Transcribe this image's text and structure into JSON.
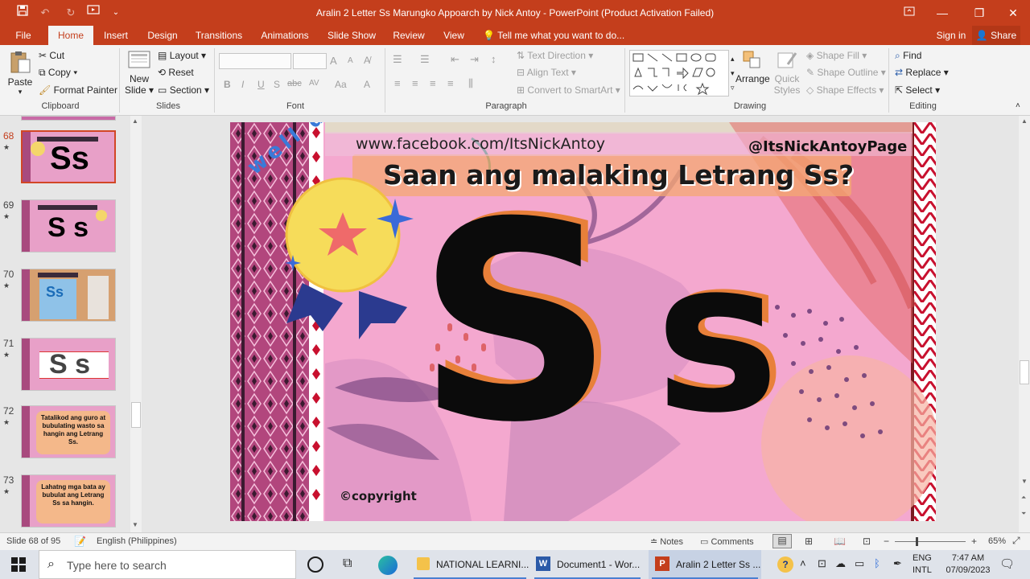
{
  "window": {
    "title": "Aralin 2 Letter Ss Marungko Appoarch by Nick Antoy - PowerPoint (Product Activation Failed)"
  },
  "tabs": [
    "File",
    "Home",
    "Insert",
    "Design",
    "Transitions",
    "Animations",
    "Slide Show",
    "Review",
    "View"
  ],
  "tell_me": "Tell me what you want to do...",
  "account": {
    "sign_in": "Sign in",
    "share": "Share"
  },
  "ribbon": {
    "clipboard": {
      "paste": "Paste",
      "cut": "Cut",
      "copy": "Copy",
      "format_painter": "Format Painter",
      "label": "Clipboard"
    },
    "slides": {
      "new_slide_line1": "New",
      "new_slide_line2": "Slide",
      "layout": "Layout",
      "reset": "Reset",
      "section": "Section",
      "label": "Slides"
    },
    "font": {
      "label": "Font",
      "bold": "B",
      "italic": "I",
      "underline": "U",
      "shadow": "S",
      "strike": "abc",
      "spacing": "AV",
      "case": "Aa",
      "color": "A",
      "grow": "A",
      "shrink": "A"
    },
    "paragraph": {
      "text_direction": "Text Direction",
      "align_text": "Align Text",
      "convert": "Convert to SmartArt",
      "label": "Paragraph"
    },
    "drawing": {
      "arrange": "Arrange",
      "quick_styles_line1": "Quick",
      "quick_styles_line2": "Styles",
      "shape_fill": "Shape Fill",
      "shape_outline": "Shape Outline",
      "shape_effects": "Shape Effects",
      "label": "Drawing"
    },
    "editing": {
      "find": "Find",
      "replace": "Replace",
      "select": "Select",
      "label": "Editing"
    }
  },
  "thumbnails": [
    {
      "num": "68",
      "star": "★",
      "selected": true,
      "caption": "Ss"
    },
    {
      "num": "69",
      "star": "★",
      "selected": false,
      "caption": "S s"
    },
    {
      "num": "70",
      "star": "★",
      "selected": false,
      "caption": "Ss"
    },
    {
      "num": "71",
      "star": "★",
      "selected": false,
      "caption": "S s"
    },
    {
      "num": "72",
      "star": "★",
      "selected": false,
      "caption": "Tatalikod ang guro at bubulating wasto sa hangin ang Letrang Ss."
    },
    {
      "num": "73",
      "star": "★",
      "selected": false,
      "caption": "Lahatng mga bata ay bubulat ang Letrang Ss sa hangin."
    }
  ],
  "slide": {
    "url": "www.facebook.com/ItsNickAntoy",
    "handle": "@ItsNickAntoyPage",
    "question": "Saan ang malaking Letrang Ss?",
    "well_done": "well done!",
    "big_letter": "S",
    "small_letter": "s",
    "copyright": "©copyright"
  },
  "status": {
    "slide_info": "Slide 68 of 95",
    "language": "English (Philippines)",
    "notes": "Notes",
    "comments": "Comments",
    "zoom": "65%"
  },
  "taskbar": {
    "search_placeholder": "Type here to search",
    "apps": [
      "NATIONAL LEARNI...",
      "Document1 - Wor...",
      "Aralin 2 Letter Ss ..."
    ],
    "lang_line1": "ENG",
    "lang_line2": "INTL",
    "time": "7:47 AM",
    "date": "07/09/2023"
  },
  "colors": {
    "accent": "#c43e1c",
    "slide_pink": "#f4a8cf",
    "letter_black": "#0b0b0b",
    "letter_shadow": "#e8803a"
  }
}
